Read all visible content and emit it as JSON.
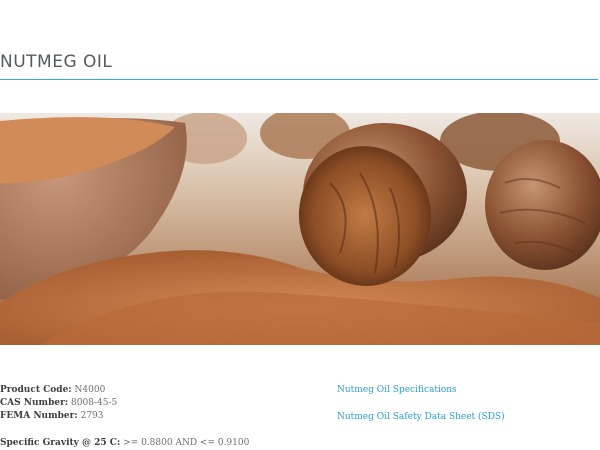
{
  "page": {
    "title": "NUTMEG OIL"
  },
  "hero": {
    "alt": "Nutmeg seeds and ground nutmeg in a wooden bowl"
  },
  "product": {
    "code_label": "Product Code:",
    "code_value": "N4000",
    "cas_label": "CAS Number:",
    "cas_value": "8008-45-5",
    "fema_label": "FEMA Number:",
    "fema_value": "2793",
    "gravity_label": "Specific Gravity @ 25 C:",
    "gravity_value": ">= 0.8800 AND <= 0.9100"
  },
  "links": {
    "specifications": "Nutmeg Oil Specifications",
    "sds": "Nutmeg Oil Safety Data Sheet (SDS)"
  },
  "colors": {
    "accent": "#36a9d9",
    "link": "#2a9ed6",
    "title_text": "#555b61"
  }
}
